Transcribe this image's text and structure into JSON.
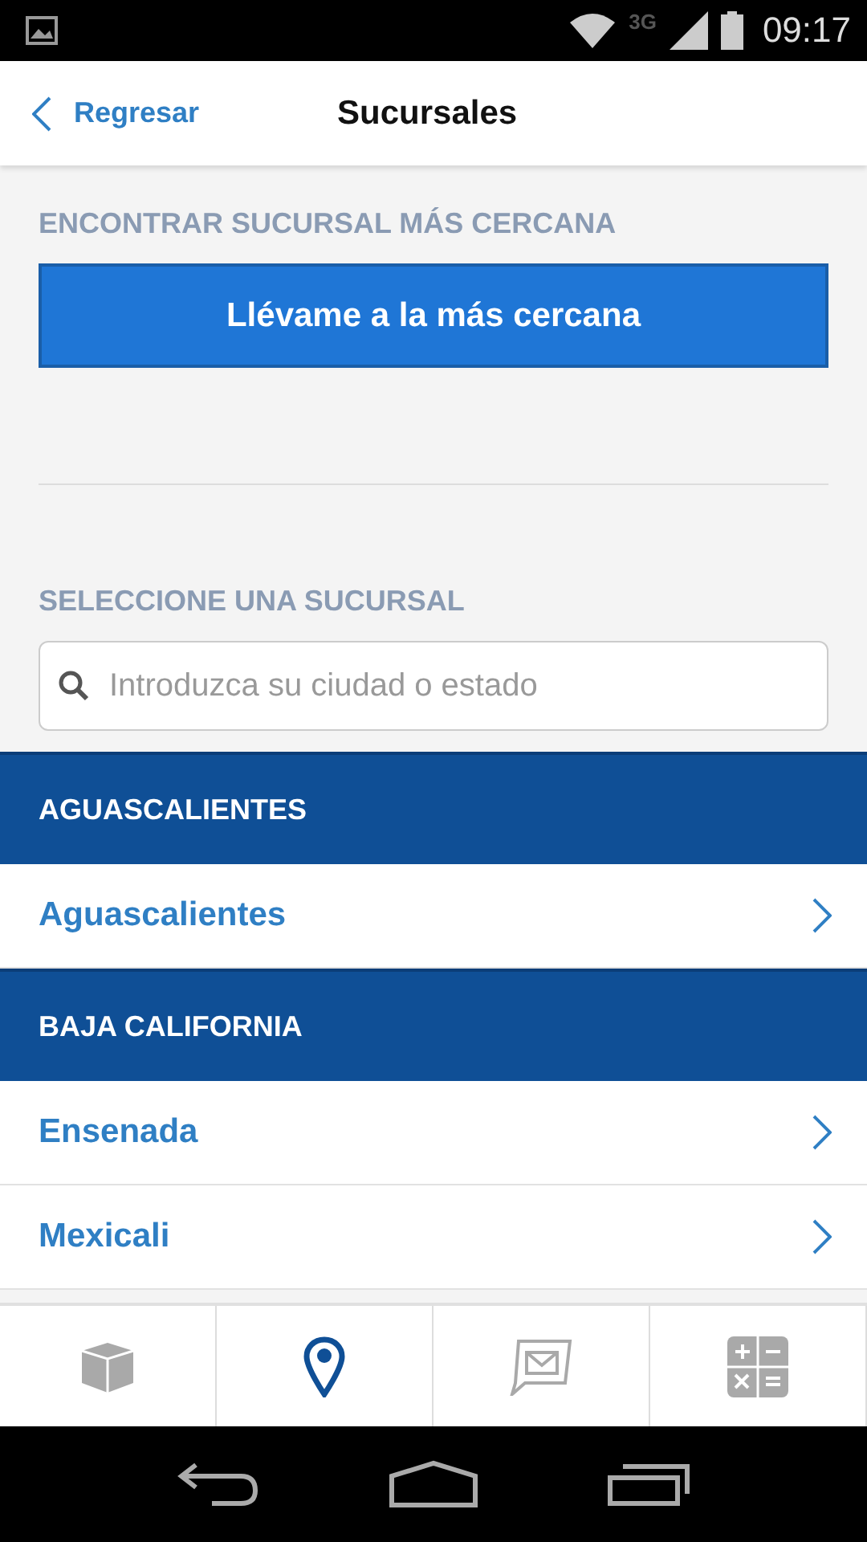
{
  "status_bar": {
    "network": "3G",
    "time": "09:17"
  },
  "header": {
    "back": "Regresar",
    "title": "Sucursales"
  },
  "nearest": {
    "label": "ENCONTRAR SUCURSAL MÁS CERCANA",
    "button": "Llévame a la más cercana"
  },
  "select": {
    "label": "SELECCIONE UNA SUCURSAL",
    "search": {
      "placeholder": "Introduzca su ciudad o estado"
    }
  },
  "groups": [
    {
      "state": "AGUASCALIENTES",
      "branches": [
        "Aguascalientes"
      ]
    },
    {
      "state": "BAJA CALIFORNIA",
      "branches": [
        "Ensenada",
        "Mexicali"
      ]
    }
  ],
  "tabs": [
    {
      "kind": "box",
      "selected": false
    },
    {
      "kind": "pin",
      "selected": true
    },
    {
      "kind": "mail",
      "selected": false
    },
    {
      "kind": "calculator",
      "selected": false
    }
  ]
}
